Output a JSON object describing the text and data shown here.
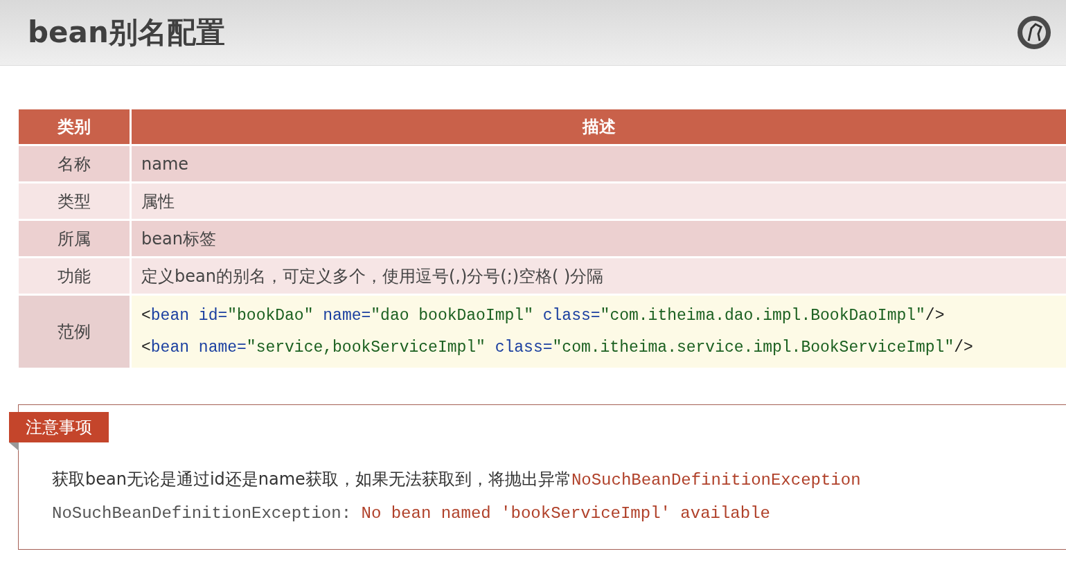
{
  "slide": {
    "title": "bean别名配置"
  },
  "table": {
    "columns": [
      "类别",
      "描述"
    ],
    "rows": [
      {
        "category": "名称",
        "kind": "text",
        "description": "name"
      },
      {
        "category": "类型",
        "kind": "text",
        "description": "属性"
      },
      {
        "category": "所属",
        "kind": "text",
        "description": "bean标签"
      },
      {
        "category": "功能",
        "kind": "text",
        "description": "定义bean的别名，可定义多个，使用逗号(,)分号(;)空格( )分隔"
      },
      {
        "category": "范例",
        "kind": "code",
        "lines": [
          [
            {
              "kind": "punct",
              "text": "<"
            },
            {
              "kind": "tag",
              "text": "bean "
            },
            {
              "kind": "attr",
              "text": "id="
            },
            {
              "kind": "value",
              "text": "\"bookDao\" "
            },
            {
              "kind": "attr",
              "text": "name="
            },
            {
              "kind": "value",
              "text": "\"dao bookDaoImpl\" "
            },
            {
              "kind": "attr",
              "text": "class="
            },
            {
              "kind": "value",
              "text": "\"com.itheima.dao.impl.BookDaoImpl\""
            },
            {
              "kind": "punct",
              "text": "/>"
            }
          ],
          [
            {
              "kind": "punct",
              "text": "<"
            },
            {
              "kind": "tag",
              "text": "bean "
            },
            {
              "kind": "attr",
              "text": "name="
            },
            {
              "kind": "value",
              "text": "\"service,bookServiceImpl\" "
            },
            {
              "kind": "attr",
              "text": "class="
            },
            {
              "kind": "value",
              "text": "\"com.itheima.service.impl.BookServiceImpl\""
            },
            {
              "kind": "punct",
              "text": "/>"
            }
          ]
        ]
      }
    ]
  },
  "note": {
    "label": "注意事项",
    "lines": [
      [
        {
          "kind": "plain",
          "text": "获取bean无论是通过id还是name获取，如果无法获取到，将抛出异常"
        },
        {
          "kind": "error",
          "text": "NoSuchBeanDefinitionException"
        }
      ],
      [
        {
          "kind": "mono",
          "text": "NoSuchBeanDefinitionException: "
        },
        {
          "kind": "error",
          "text": "No bean named 'bookServiceImpl' available"
        }
      ]
    ]
  }
}
